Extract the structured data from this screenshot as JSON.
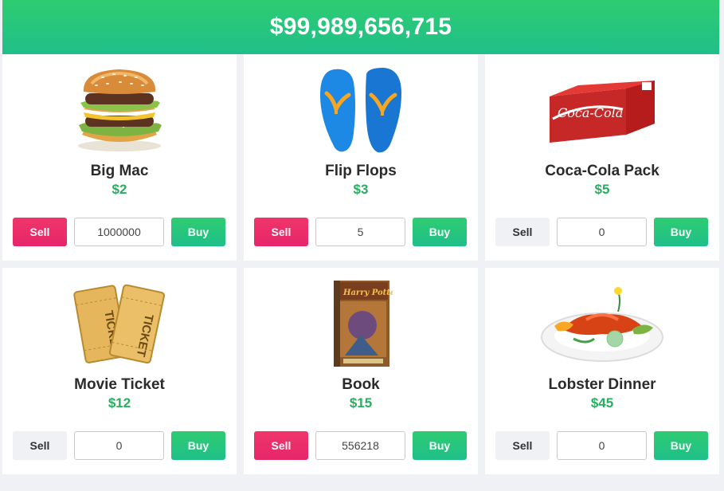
{
  "header": {
    "balance": "$99,989,656,715"
  },
  "products": [
    {
      "name": "Big Mac",
      "price": "$2",
      "quantity": "1000000",
      "sell_label": "Sell",
      "buy_label": "Buy",
      "image": "burger-image"
    },
    {
      "name": "Flip Flops",
      "price": "$3",
      "quantity": "5",
      "sell_label": "Sell",
      "buy_label": "Buy",
      "image": "flip-flops-image"
    },
    {
      "name": "Coca-Cola Pack",
      "price": "$5",
      "quantity": "0",
      "sell_label": "Sell",
      "buy_label": "Buy",
      "image": "coca-cola-pack-image"
    },
    {
      "name": "Movie Ticket",
      "price": "$12",
      "quantity": "0",
      "sell_label": "Sell",
      "buy_label": "Buy",
      "image": "movie-ticket-image"
    },
    {
      "name": "Book",
      "price": "$15",
      "quantity": "556218",
      "sell_label": "Sell",
      "buy_label": "Buy",
      "image": "book-image"
    },
    {
      "name": "Lobster Dinner",
      "price": "$45",
      "quantity": "0",
      "sell_label": "Sell",
      "buy_label": "Buy",
      "image": "lobster-dinner-image"
    }
  ],
  "colors": {
    "accent": "#2ecc71",
    "sell_active": "#e5266a",
    "price": "#27ae60"
  },
  "image_text": {
    "coke_brand": "Coca-Cola",
    "ticket_word": "TICKET",
    "book_title": "Harry Potter"
  }
}
